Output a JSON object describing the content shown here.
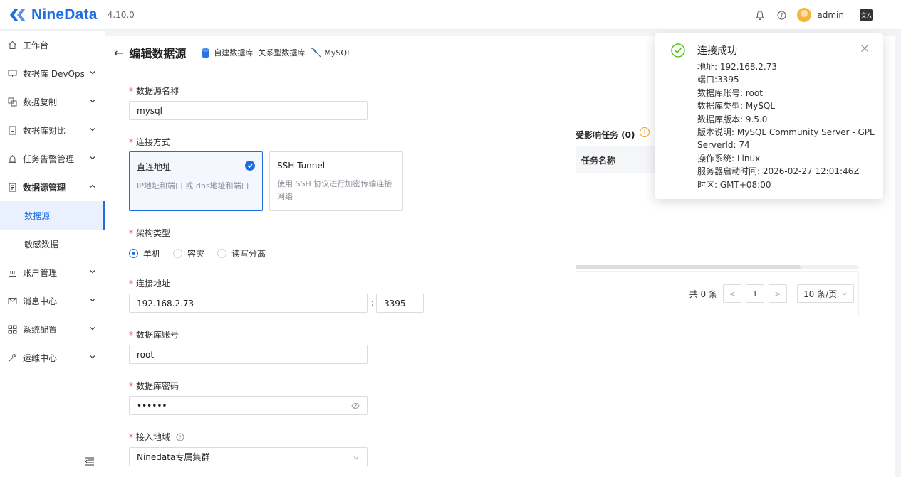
{
  "app": {
    "name": "NineData",
    "version": "4.10.0",
    "brand_color": "#1d6fe0"
  },
  "topbar": {
    "user": "admin"
  },
  "sidebar": {
    "items": [
      {
        "label": "工作台",
        "icon": "home-icon",
        "expandable": false
      },
      {
        "label": "数据库 DevOps",
        "icon": "monitor-icon",
        "expandable": true
      },
      {
        "label": "数据复制",
        "icon": "copy-icon",
        "expandable": true
      },
      {
        "label": "数据库对比",
        "icon": "compare-icon",
        "expandable": true
      },
      {
        "label": "任务告警管理",
        "icon": "alarm-icon",
        "expandable": true
      },
      {
        "label": "数据源管理",
        "icon": "datasource-icon",
        "expandable": true,
        "expanded": true,
        "children": [
          {
            "label": "数据源",
            "active": true
          },
          {
            "label": "敏感数据",
            "active": false
          }
        ]
      },
      {
        "label": "账户管理",
        "icon": "account-icon",
        "expandable": true
      },
      {
        "label": "消息中心",
        "icon": "mail-icon",
        "expandable": true
      },
      {
        "label": "系统配置",
        "icon": "grid-icon",
        "expandable": true
      },
      {
        "label": "运维中心",
        "icon": "wrench-icon",
        "expandable": true
      }
    ]
  },
  "header": {
    "title": "编辑数据源",
    "crumbs": [
      "自建数据库",
      "关系型数据库",
      "MySQL"
    ]
  },
  "form": {
    "name_label": "数据源名称",
    "name_value": "mysql",
    "conn_label": "连接方式",
    "conn_options": [
      {
        "title": "直连地址",
        "desc": "IP地址和端口 或 dns地址和端口",
        "selected": true
      },
      {
        "title": "SSH Tunnel",
        "desc": "使用 SSH 协议进行加密传输连接网络",
        "selected": false
      }
    ],
    "arch_label": "架构类型",
    "arch_options": [
      {
        "label": "单机",
        "selected": true
      },
      {
        "label": "容灾",
        "selected": false
      },
      {
        "label": "读写分离",
        "selected": false
      }
    ],
    "addr_label": "连接地址",
    "host_value": "192.168.2.73",
    "port_separator": ":",
    "port_value": "3395",
    "account_label": "数据库账号",
    "account_value": "root",
    "password_label": "数据库密码",
    "password_value": "••••••",
    "region_label": "接入地域",
    "region_value": "Ninedata专属集群"
  },
  "tasks": {
    "title": "受影响任务 (0)",
    "column": "任务名称",
    "total": "共 0 条",
    "page": "1",
    "page_size": "10 条/页"
  },
  "toast": {
    "title": "连接成功",
    "lines": [
      "地址: 192.168.2.73",
      "端口:3395",
      "数据库账号: root",
      "数据库类型: MySQL",
      "数据库版本: 9.5.0",
      "版本说明: MySQL Community Server - GPL",
      "ServerId: 74",
      "操作系统: Linux",
      "服务器启动时间: 2026-02-27 12:01:46Z",
      "时区: GMT+08:00"
    ],
    "success_color": "#52c41a"
  }
}
